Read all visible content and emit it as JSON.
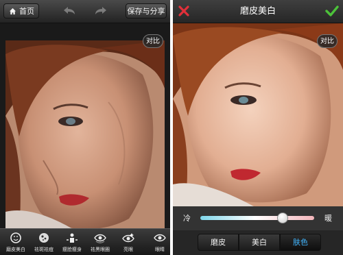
{
  "left": {
    "header": {
      "home_label": "首页",
      "share_label": "保存与分享"
    },
    "compare_label": "对比",
    "tools": [
      {
        "label": "磨皮美白",
        "icon": "face-smooth-icon"
      },
      {
        "label": "祛斑祛痘",
        "icon": "spot-remove-icon"
      },
      {
        "label": "瘦脸瘦身",
        "icon": "slim-icon"
      },
      {
        "label": "祛黑眼圈",
        "icon": "dark-circle-icon"
      },
      {
        "label": "亮眼",
        "icon": "bright-eye-icon"
      },
      {
        "label": "眼睛",
        "icon": "eye-icon"
      }
    ]
  },
  "right": {
    "title": "磨皮美白",
    "compare_label": "对比",
    "slider": {
      "left_label": "冷",
      "right_label": "暖",
      "value": 0.72
    },
    "segments": [
      {
        "label": "磨皮",
        "active": false
      },
      {
        "label": "美白",
        "active": false
      },
      {
        "label": "肤色",
        "active": true
      }
    ]
  },
  "colors": {
    "accent_active": "#41b6ff",
    "close": "#e0303a",
    "confirm": "#4cc23a"
  }
}
